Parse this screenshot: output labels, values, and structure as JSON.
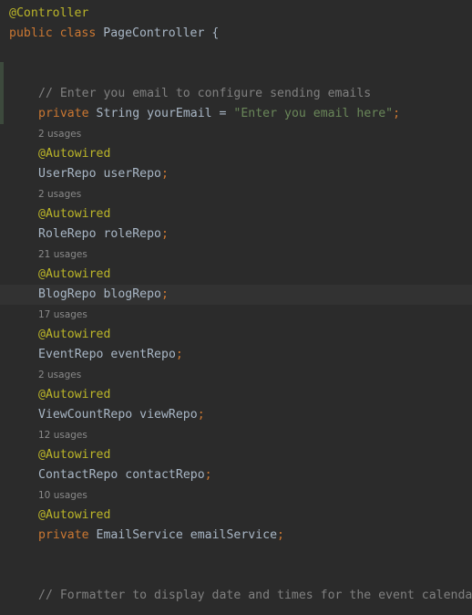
{
  "editor": {
    "header": {
      "annotation": "@Controller",
      "class_kw1": "public",
      "class_kw2": "class",
      "class_name": "PageController",
      "brace": "{"
    },
    "comment1": "// Enter you email to configure sending emails",
    "email_line": {
      "modifier": "private",
      "type": "String",
      "name": "yourEmail",
      "eq": " = ",
      "value": "\"Enter you email here\"",
      "semi": ";"
    },
    "annotation": "@Autowired",
    "fields": [
      {
        "usages": "2 usages",
        "type": "UserRepo",
        "name": "userRepo"
      },
      {
        "usages": "2 usages",
        "type": "RoleRepo",
        "name": "roleRepo"
      },
      {
        "usages": "21 usages",
        "type": "BlogRepo",
        "name": "blogRepo"
      },
      {
        "usages": "17 usages",
        "type": "EventRepo",
        "name": "eventRepo"
      },
      {
        "usages": "2 usages",
        "type": "ViewCountRepo",
        "name": "viewRepo"
      },
      {
        "usages": "12 usages",
        "type": "ContactRepo",
        "name": "contactRepo"
      },
      {
        "usages": "10 usages",
        "modifier": "private",
        "type": "EmailService",
        "name": "emailService"
      }
    ],
    "semi": ";",
    "comment2": "// Formatter to display date and times for the event calenda"
  },
  "colors": {
    "background": "#2b2b2b",
    "keyword": "#cc7832",
    "annotation": "#bbb529",
    "string": "#6a8759",
    "comment": "#808080",
    "text": "#a9b7c6",
    "usage_hint": "#8a8a8a"
  }
}
